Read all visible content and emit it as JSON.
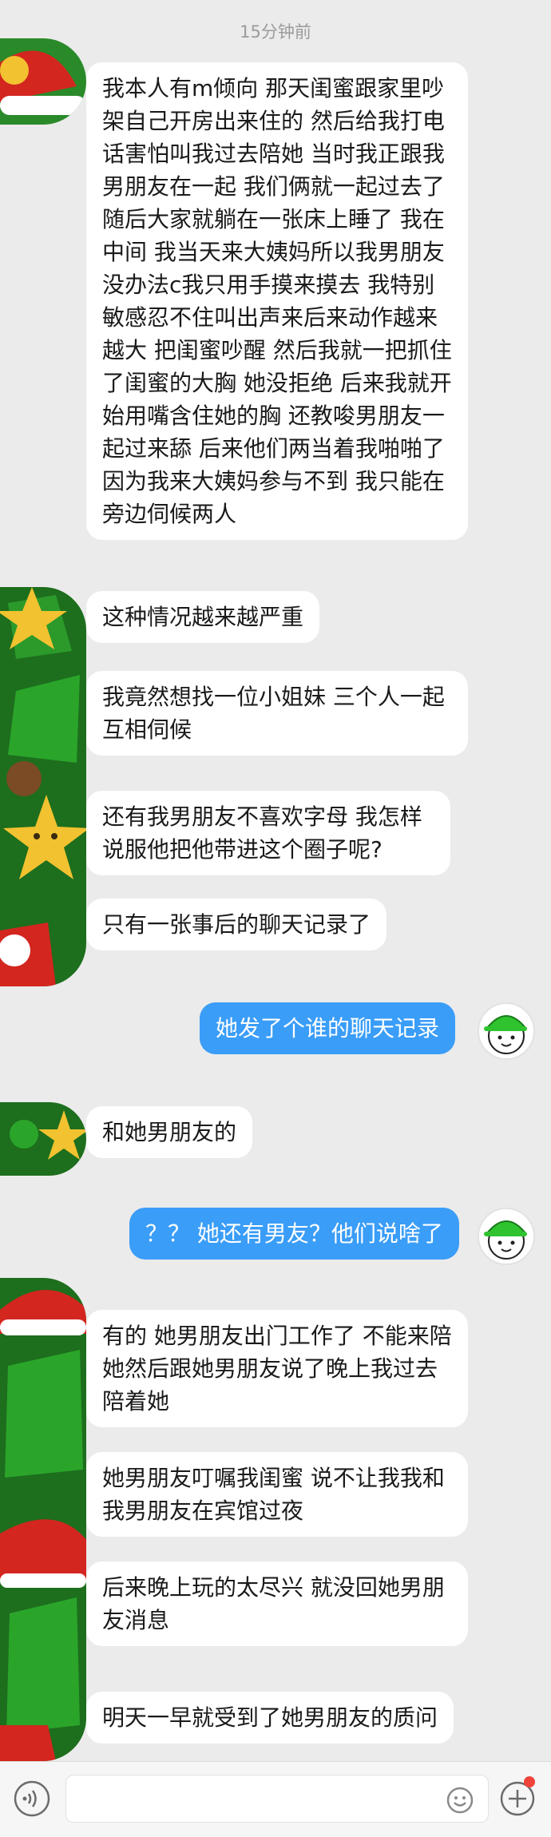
{
  "timestamp": "15分钟前",
  "messages_left_1": [
    "我本人有m倾向 那天闺蜜跟家里吵架自己开房出来住的 然后给我打电话害怕叫我过去陪她 当时我正跟我男朋友在一起 我们俩就一起过去了 随后大家就躺在一张床上睡了 我在中间 我当天来大姨妈所以我男朋友没办法c我只用手摸来摸去 我特别敏感忍不住叫出声来后来动作越来越大 把闺蜜吵醒 然后我就一把抓住了闺蜜的大胸 她没拒绝 后来我就开始用嘴含住她的胸 还教唆男朋友一起过来舔 后来他们两当着我啪啪了 因为我来大姨妈参与不到 我只能在旁边伺候两人",
    "这种情况越来越严重",
    "我竟然想找一位小姐妹 三个人一起互相伺候",
    "还有我男朋友不喜欢字母 我怎样说服他把他带进这个圈子呢?",
    "只有一张事后的聊天记录了"
  ],
  "message_right_1": "她发了个谁的聊天记录",
  "message_left_2": "和她男朋友的",
  "message_right_2": "？？ 她还有男友？他们说啥了",
  "messages_left_3": [
    "有的  她男朋友出门工作了 不能来陪她然后跟她男朋友说了晚上我过去陪着她",
    "她男朋友叮嘱我闺蜜 说不让我我和我男朋友在宾馆过夜",
    "后来晚上玩的太尽兴 就没回她男朋友消息",
    "明天一早就受到了她男朋友的质问"
  ],
  "input": {
    "placeholder": "",
    "value": ""
  },
  "icons": {
    "voice": "voice-icon",
    "emoji": "emoji-icon",
    "add": "add-icon",
    "notification_dot": "#f0433a"
  },
  "colors": {
    "background": "#ebebeb",
    "left_bubble": "#ffffff",
    "right_bubble": "#3a9df8",
    "timestamp": "#9b9b9b"
  }
}
